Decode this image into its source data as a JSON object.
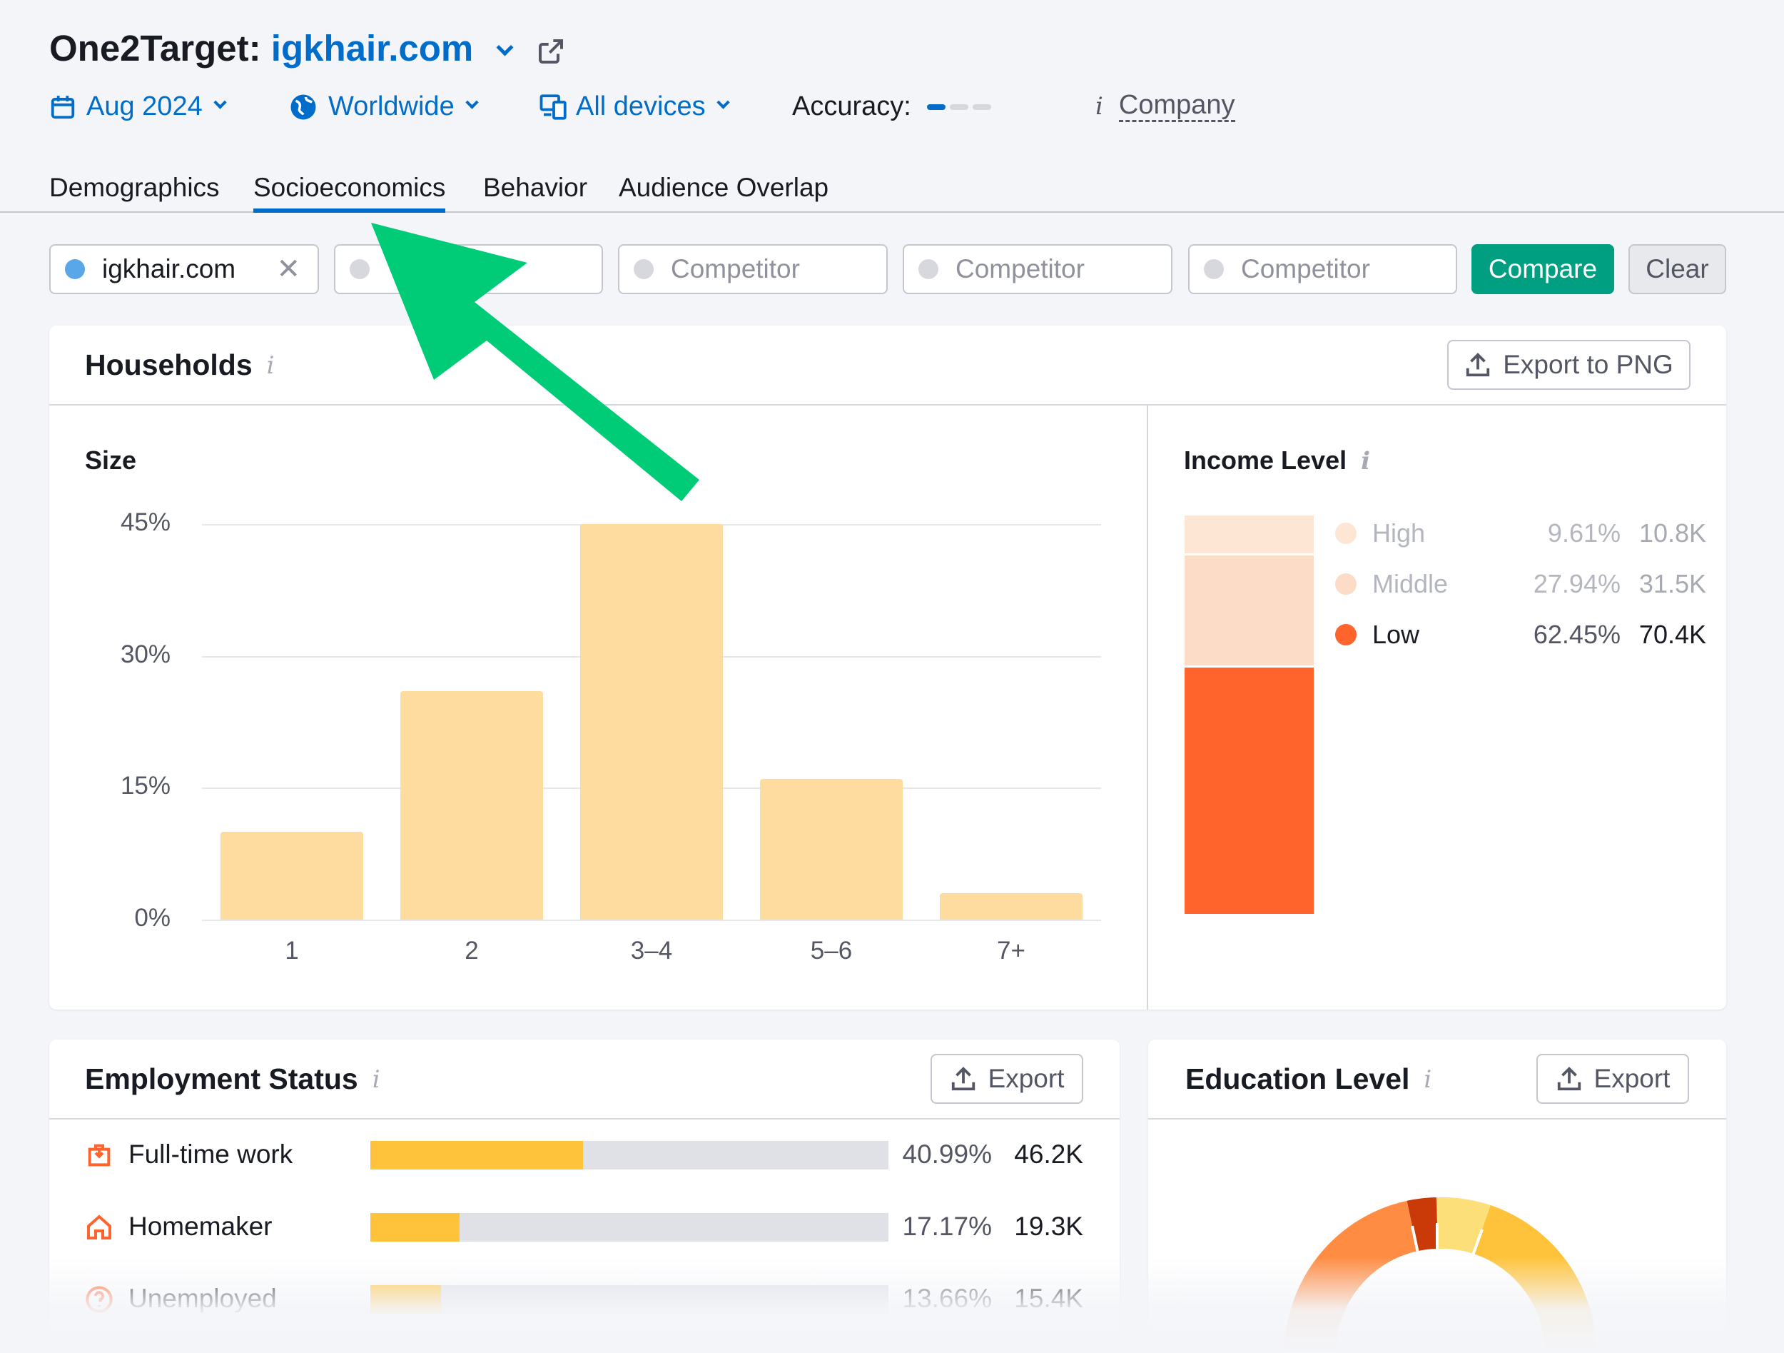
{
  "header": {
    "title_prefix": "One2Target:",
    "domain": "igkhair.com"
  },
  "filters": {
    "date": "Aug 2024",
    "region": "Worldwide",
    "devices": "All devices",
    "accuracy_label": "Accuracy:",
    "company_label": "Company"
  },
  "tabs": [
    "Demographics",
    "Socioeconomics",
    "Behavior",
    "Audience Overlap"
  ],
  "active_tab": "Socioeconomics",
  "compare_bar": {
    "domain_value": "igkhair.com",
    "competitor_placeholder": "Competitor",
    "compare_label": "Compare",
    "clear_label": "Clear"
  },
  "households": {
    "title": "Households",
    "export_label": "Export to PNG",
    "size_title": "Size",
    "income_title": "Income Level",
    "income": [
      {
        "label": "High",
        "percent": "9.61%",
        "count": "10.8K",
        "value": 9.61,
        "color": "#fde6d4"
      },
      {
        "label": "Middle",
        "percent": "27.94%",
        "count": "31.5K",
        "value": 27.94,
        "color": "#fcdcc7"
      },
      {
        "label": "Low",
        "percent": "62.45%",
        "count": "70.4K",
        "value": 62.45,
        "color": "#ff642d"
      }
    ]
  },
  "chart_data": {
    "type": "bar",
    "categories": [
      "1",
      "2",
      "3–4",
      "5–6",
      "7+"
    ],
    "values": [
      10,
      26,
      45,
      16,
      3
    ],
    "yticks": [
      "0%",
      "15%",
      "30%",
      "45%"
    ],
    "ylim": [
      0,
      45
    ],
    "color": "#fedca0",
    "title": "Size"
  },
  "employment": {
    "title": "Employment Status",
    "export_label": "Export",
    "rows": [
      {
        "label": "Full-time work",
        "percent": "40.99%",
        "count": "46.2K",
        "value": 40.99,
        "icon": "briefcase-icon"
      },
      {
        "label": "Homemaker",
        "percent": "17.17%",
        "count": "19.3K",
        "value": 17.17,
        "icon": "home-icon"
      },
      {
        "label": "Unemployed",
        "percent": "13.66%",
        "count": "15.4K",
        "value": 13.66,
        "icon": "question-circle-icon"
      }
    ]
  },
  "education": {
    "title": "Education Level",
    "export_label": "Export"
  },
  "colors": {
    "brand_blue": "#006dca",
    "compare_green": "#009f81",
    "annotation_arrow": "#00cc78",
    "orange": "#ff642d",
    "bar_yellow": "#ffc33b"
  }
}
